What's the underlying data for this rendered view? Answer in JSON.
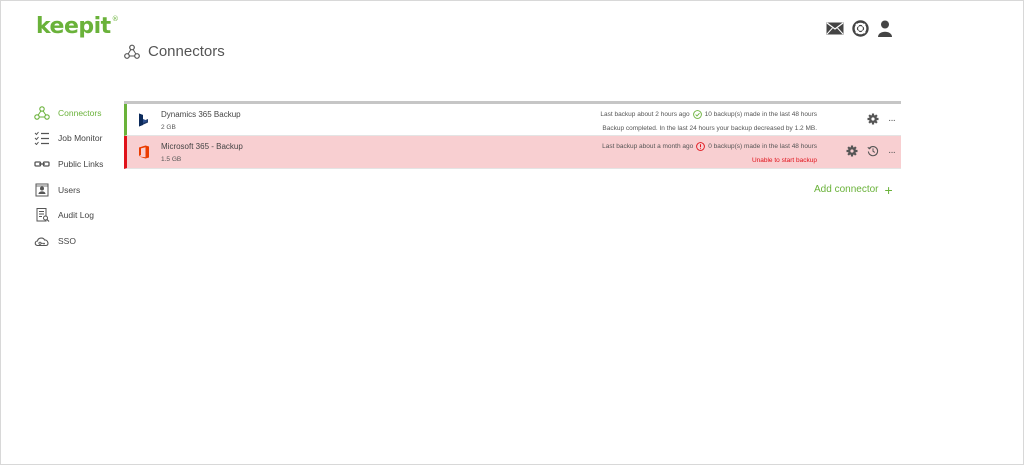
{
  "brand": {
    "logo_text": "keepit",
    "logo_mark": "®",
    "accent": "#6ab23a",
    "error": "#e0121a"
  },
  "header": {
    "icons": [
      "mail-icon",
      "help-lifebuoy-icon",
      "user-icon"
    ]
  },
  "page": {
    "title": "Connectors"
  },
  "sidebar": {
    "items": [
      {
        "label": "Connectors",
        "icon": "connectors-icon",
        "active": true
      },
      {
        "label": "Job Monitor",
        "icon": "job-monitor-icon"
      },
      {
        "label": "Public Links",
        "icon": "link-icon"
      },
      {
        "label": "Users",
        "icon": "users-icon"
      },
      {
        "label": "Audit Log",
        "icon": "audit-log-icon"
      },
      {
        "label": "SSO",
        "icon": "cloud-key-icon"
      }
    ]
  },
  "connectors": [
    {
      "name": "Dynamics 365 Backup",
      "size": "2 GB",
      "last_backup": "Last backup about 2 hours ago",
      "backups_48h": "10 backup(s) made in the last 48 hours",
      "status_text": "Backup completed. In the last 24 hours your backup decreased by 1.2 MB.",
      "state": "ok"
    },
    {
      "name": "Microsoft 365 - Backup",
      "size": "1.5 GB",
      "last_backup": "Last backup about a month ago",
      "backups_48h": "0 backup(s) made in the last 48 hours",
      "status_text": "Unable to start backup",
      "state": "error"
    }
  ],
  "actions": {
    "add_connector": "Add connector",
    "add_symbol": "+",
    "more": "···"
  }
}
